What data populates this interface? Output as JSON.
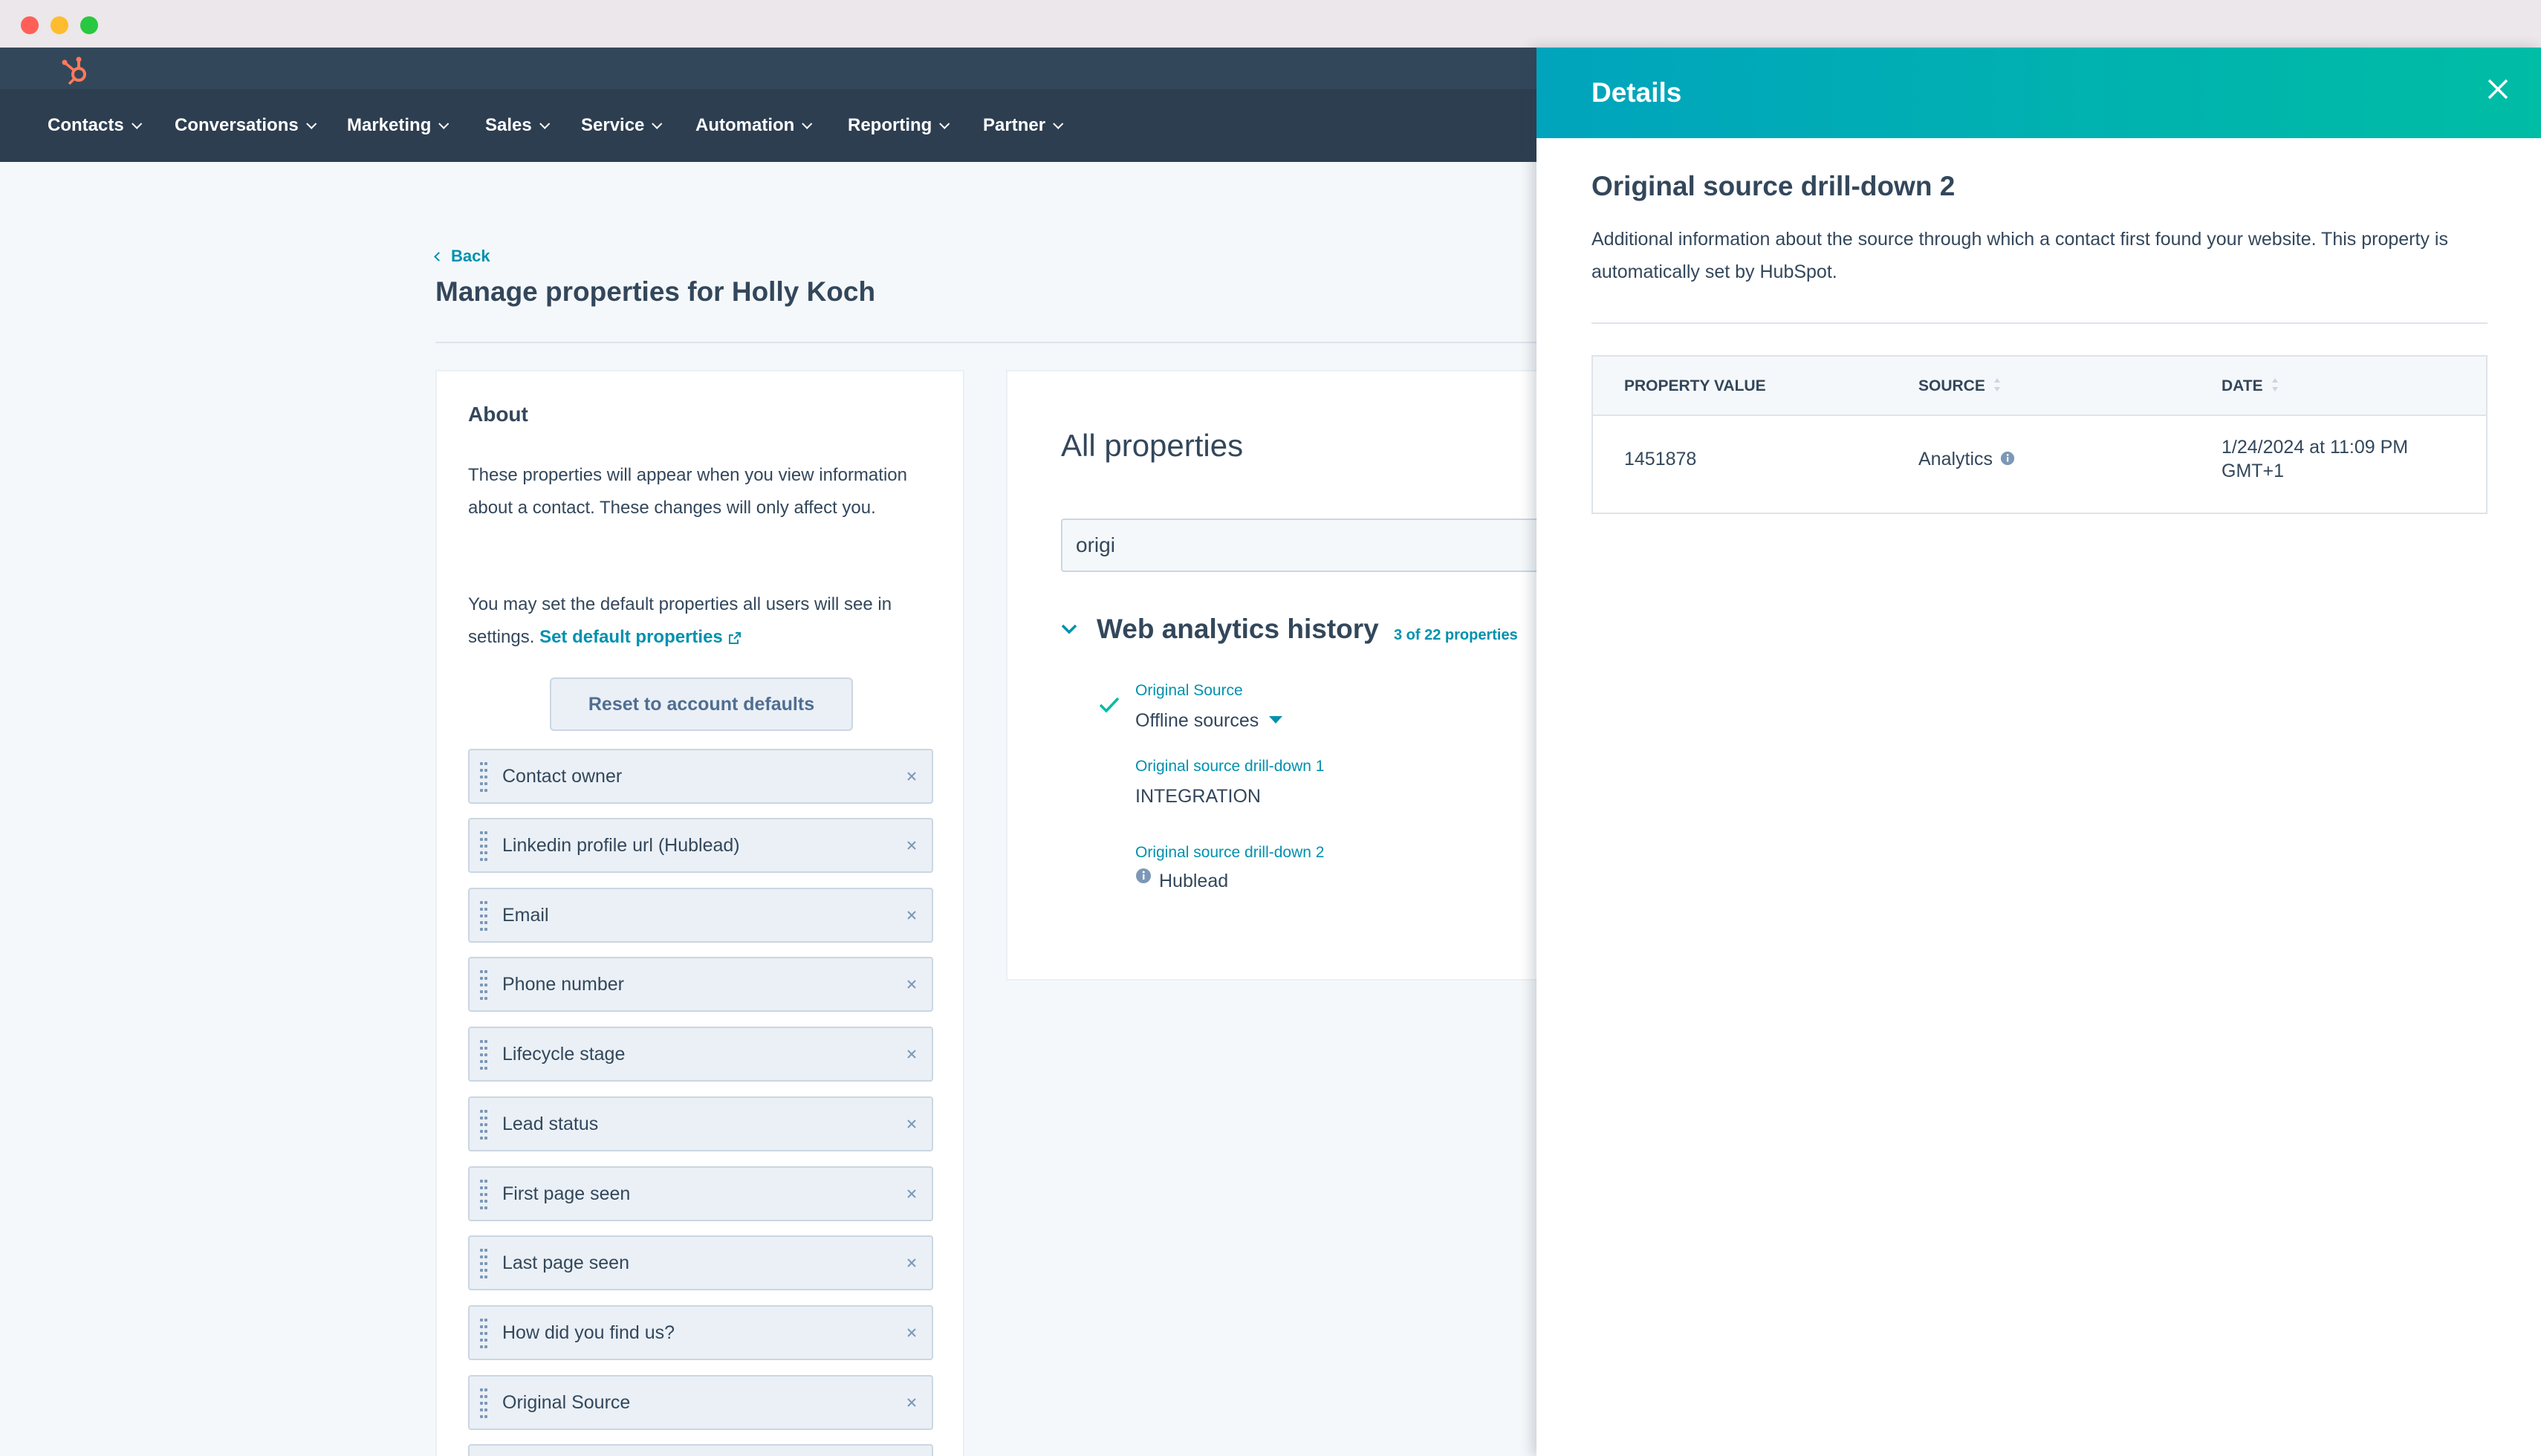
{
  "nav": {
    "items": [
      {
        "label": "Contacts"
      },
      {
        "label": "Conversations"
      },
      {
        "label": "Marketing"
      },
      {
        "label": "Sales"
      },
      {
        "label": "Service"
      },
      {
        "label": "Automation"
      },
      {
        "label": "Reporting"
      },
      {
        "label": "Partner"
      }
    ]
  },
  "page": {
    "back_label": "Back",
    "title": "Manage properties for Holly Koch"
  },
  "about": {
    "title": "About",
    "paragraph1": "These properties will appear when you view information about a contact. These changes will only affect you.",
    "paragraph2_prefix": "You may set the default properties all users will see in settings.",
    "set_default_link": "Set default properties",
    "reset_button": "Reset to account defaults",
    "properties": [
      {
        "label": "Contact owner"
      },
      {
        "label": "Linkedin profile url (Hublead)"
      },
      {
        "label": "Email"
      },
      {
        "label": "Phone number"
      },
      {
        "label": "Lifecycle stage"
      },
      {
        "label": "Lead status"
      },
      {
        "label": "First page seen"
      },
      {
        "label": "Last page seen"
      },
      {
        "label": "How did you find us?"
      },
      {
        "label": "Original Source"
      }
    ]
  },
  "all_properties": {
    "title": "All properties",
    "search_value": "origi",
    "group_title": "Web analytics history",
    "group_count": "3 of 22 properties",
    "fields": [
      {
        "label": "Original Source",
        "value": "Offline sources"
      },
      {
        "label": "Original source drill-down 1",
        "value": "INTEGRATION"
      },
      {
        "label": "Original source drill-down 2",
        "value": "Hublead"
      }
    ]
  },
  "details": {
    "panel_title": "Details",
    "heading": "Original source drill-down 2",
    "description": "Additional information about the source through which a contact first found your website. This property is automatically set by HubSpot.",
    "table": {
      "headers": {
        "value": "PROPERTY VALUE",
        "source": "SOURCE",
        "date": "DATE"
      },
      "rows": [
        {
          "value": "1451878",
          "source": "Analytics",
          "date": "1/24/2024 at 11:09 PM GMT+1"
        }
      ]
    }
  },
  "colors": {
    "nav_bg": "#2d3e50",
    "accent": "#0091ae",
    "panel_gradient_start": "#00a4bd",
    "panel_gradient_end": "#00bda5",
    "brand_orange": "#ff7a59"
  }
}
